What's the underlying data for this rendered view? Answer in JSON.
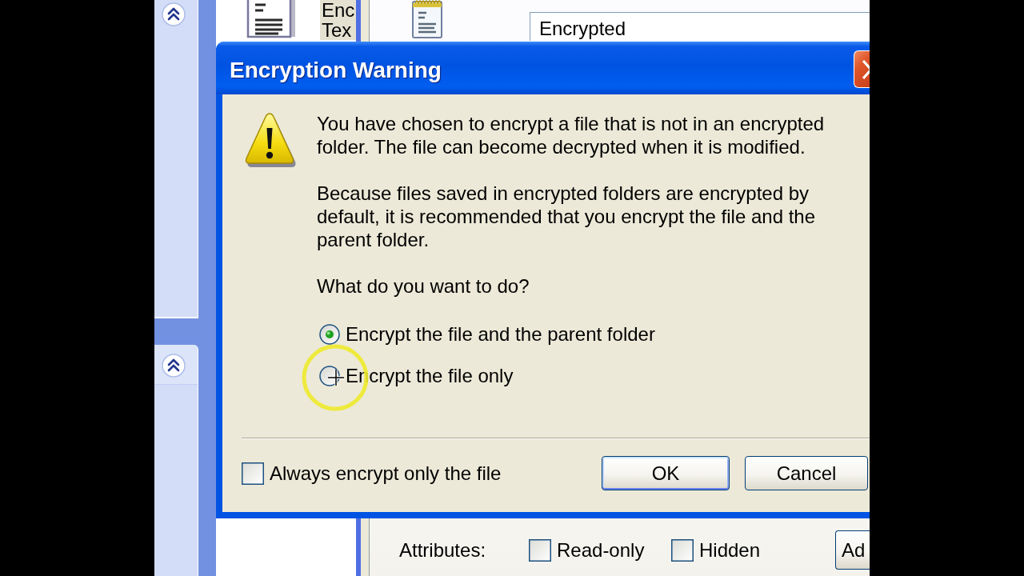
{
  "explorer": {
    "task_pane": {
      "sections": [
        {
          "expanded": true
        },
        {
          "expanded": true
        }
      ]
    },
    "file": {
      "label": "Enc Tex",
      "selected": true
    }
  },
  "properties": {
    "name_field": {
      "value": "Encrypted"
    },
    "attributes": {
      "label": "Attributes:",
      "options": [
        {
          "label": "Read-only",
          "checked": false
        },
        {
          "label": "Hidden",
          "checked": false
        }
      ]
    },
    "button": {
      "label": "Ad"
    }
  },
  "dialog": {
    "title": "Encryption Warning",
    "paragraphs": [
      "You have chosen to encrypt a file that is not in an encrypted folder. The file can become decrypted when it is modified.",
      "Because files saved in encrypted folders are encrypted by default, it is recommended that you encrypt the file and the parent folder."
    ],
    "question": "What do you want to do?",
    "choices": [
      {
        "label": "Encrypt the file and the parent folder",
        "selected": true
      },
      {
        "label": "Encrypt the file only",
        "selected": false
      }
    ],
    "always_option": {
      "label": "Always encrypt only the file",
      "checked": false
    },
    "buttons": [
      {
        "label": "OK",
        "default": true
      },
      {
        "label": "Cancel",
        "default": false
      }
    ]
  }
}
